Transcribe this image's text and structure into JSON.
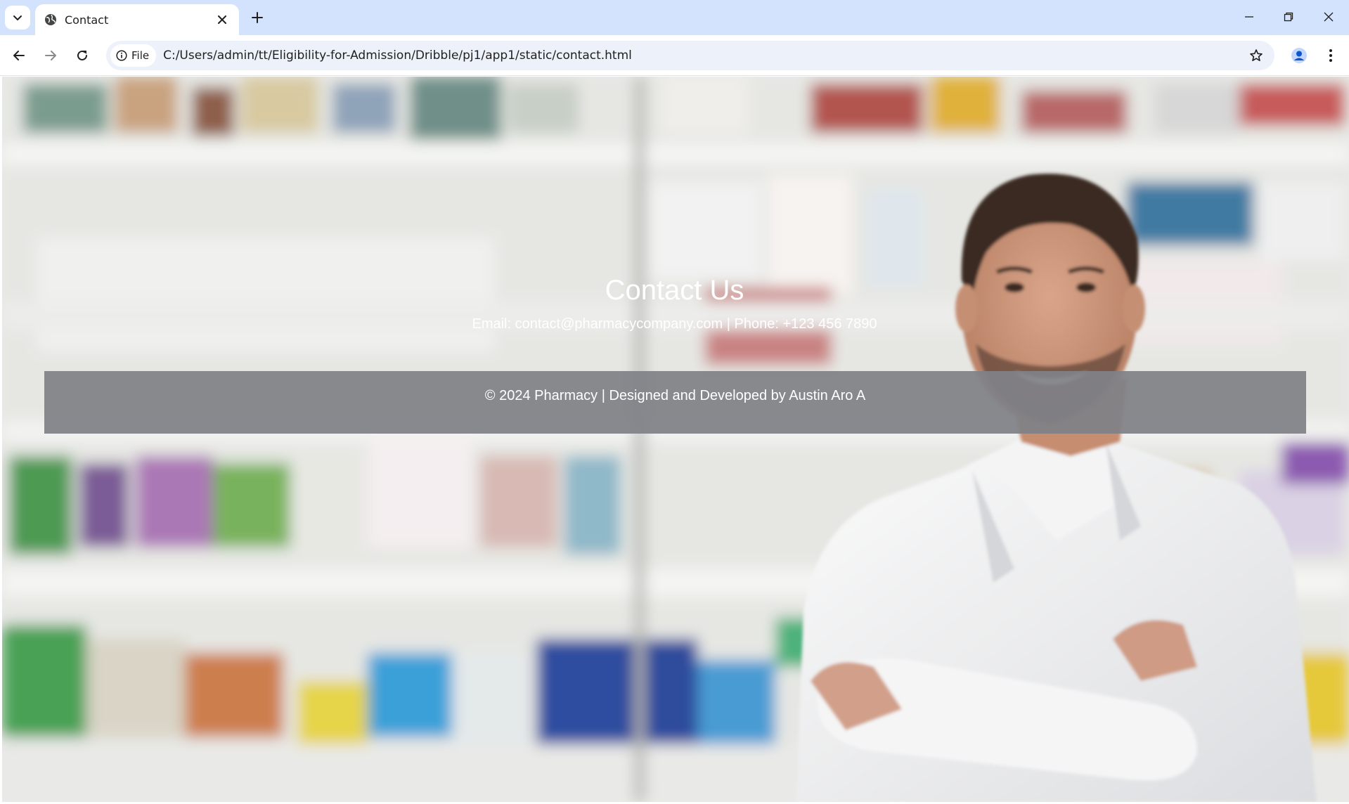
{
  "browser": {
    "tab": {
      "title": "Contact",
      "favicon": "globe-icon"
    },
    "omnibox": {
      "chip_label": "File",
      "url": "C:/Users/admin/tt/Eligibility-for-Admission/Dribble/pj1/app1/static/contact.html"
    },
    "colors": {
      "tabstrip": "#d3e3fd",
      "omnibox": "#edf2fa"
    }
  },
  "page": {
    "heading": "Contact Us",
    "contact_line": "Email: contact@pharmacycompany.com | Phone: +123 456 7890",
    "footer_text": "© 2024 Pharmacy | Designed and Developed by Austin Aro A",
    "colors": {
      "footer_bg": "#808186",
      "text": "#ffffff"
    },
    "background_image": "blurred pharmacy shelves with smiling pharmacist in white coat"
  }
}
